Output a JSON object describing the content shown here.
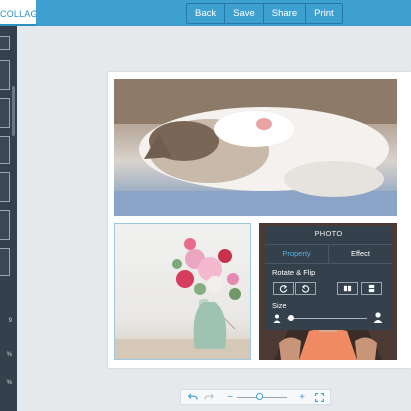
{
  "app": {
    "tab_label": "COLLAGE"
  },
  "toolbar": {
    "back": "Back",
    "save": "Save",
    "share": "Share",
    "print": "Print"
  },
  "sidebar": {
    "values": [
      "9",
      "%",
      "%"
    ]
  },
  "collage": {
    "photos": [
      {
        "subject": "sleeping cat"
      },
      {
        "subject": "flowers in vase"
      },
      {
        "subject": "person"
      }
    ]
  },
  "photo_panel": {
    "title": "PHOTO",
    "tabs": [
      "Property",
      "Effect"
    ],
    "active_tab": "Property",
    "rotate_flip_label": "Rotate & Flip",
    "size_label": "Size",
    "size_level": 0.05
  },
  "zoom": {
    "minus": "−",
    "plus": "+",
    "level": 0.45
  },
  "colors": {
    "accent": "#3ea0d1",
    "panel": "#34404b",
    "active_tab": "#4fb0e3"
  },
  "icons": [
    "undo-icon",
    "redo-icon",
    "rotate-left-icon",
    "rotate-right-icon",
    "flip-horizontal-icon",
    "flip-vertical-icon",
    "person-small-icon",
    "person-large-icon",
    "fullscreen-icon"
  ]
}
